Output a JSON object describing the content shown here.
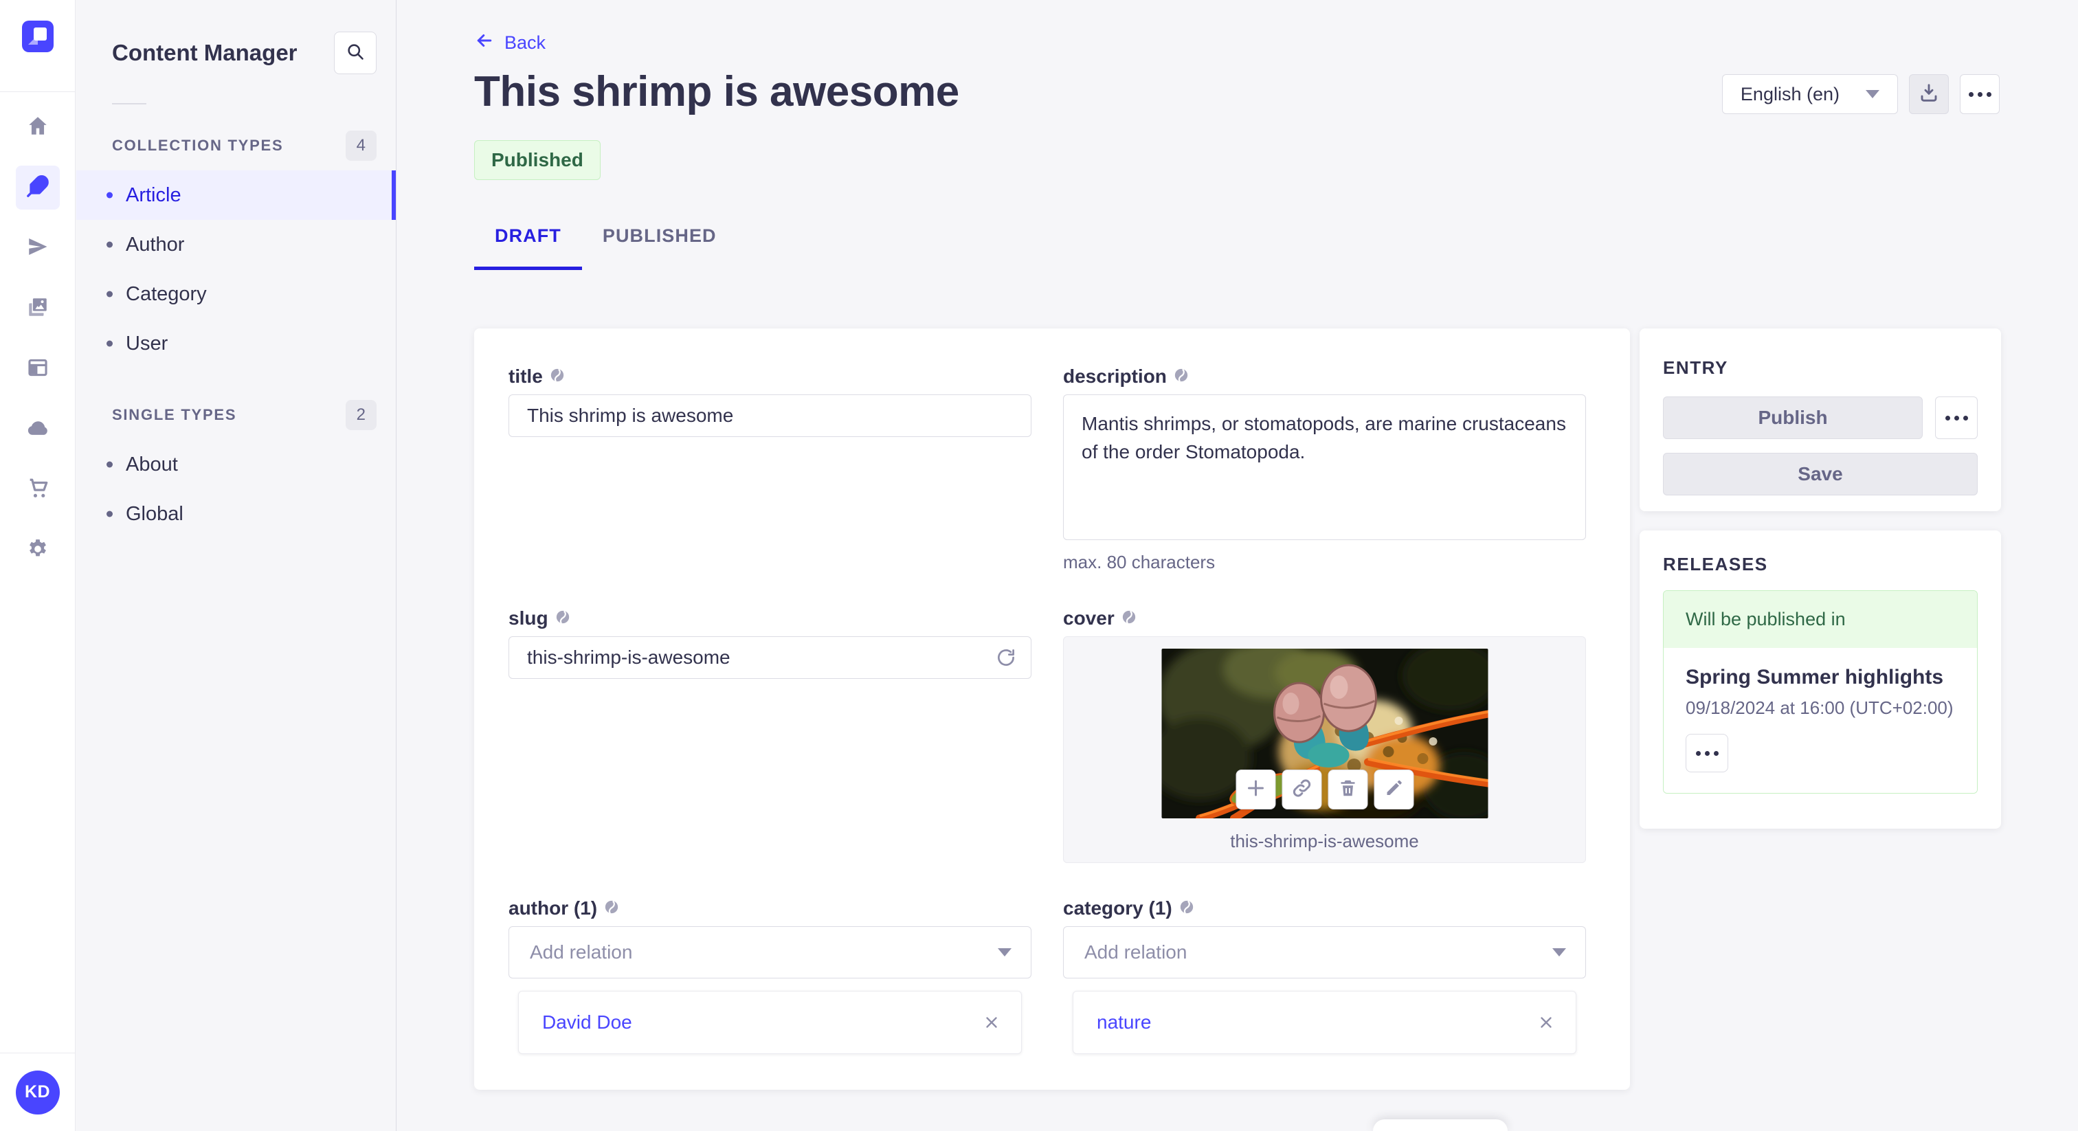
{
  "colors": {
    "primary": "#4945ff",
    "primary_dark": "#271fe0",
    "text": "#32324d",
    "text_secondary": "#666687",
    "success_text": "#2f6846",
    "success_bg": "#eafbe7",
    "success_border": "#c6f0c2",
    "page_bg": "#f6f6f9"
  },
  "rail": {
    "logo_icon": "strapi-logo",
    "icons": [
      "home-icon",
      "feather-icon",
      "paper-plane-icon",
      "media-library-icon",
      "layout-icon",
      "cloud-icon",
      "cart-icon",
      "gear-icon"
    ],
    "avatar_initials": "KD"
  },
  "sidebar": {
    "title": "Content Manager",
    "search_icon": "search-icon",
    "sections": [
      {
        "label": "COLLECTION TYPES",
        "badge": "4",
        "items": [
          {
            "label": "Article",
            "active": true
          },
          {
            "label": "Author",
            "active": false
          },
          {
            "label": "Category",
            "active": false
          },
          {
            "label": "User",
            "active": false
          }
        ]
      },
      {
        "label": "SINGLE TYPES",
        "badge": "2",
        "items": [
          {
            "label": "About",
            "active": false
          },
          {
            "label": "Global",
            "active": false
          }
        ]
      }
    ]
  },
  "header": {
    "back_label": "Back",
    "title": "This shrimp is awesome",
    "status": "Published",
    "locale": "English (en)",
    "tabs": [
      {
        "label": "DRAFT",
        "active": true
      },
      {
        "label": "PUBLISHED",
        "active": false
      }
    ]
  },
  "form": {
    "title": {
      "label": "title",
      "value": "This shrimp is awesome"
    },
    "description": {
      "label": "description",
      "value": "Mantis shrimps, or stomatopods, are marine crustaceans of the order Stomatopoda.",
      "hint": "max. 80 characters"
    },
    "slug": {
      "label": "slug",
      "value": "this-shrimp-is-awesome"
    },
    "cover": {
      "label": "cover",
      "caption": "this-shrimp-is-awesome"
    },
    "author": {
      "label": "author (1)",
      "placeholder": "Add relation",
      "relation": "David Doe"
    },
    "category": {
      "label": "category (1)",
      "placeholder": "Add relation",
      "relation": "nature"
    }
  },
  "entry_panel": {
    "heading": "ENTRY",
    "publish_label": "Publish",
    "save_label": "Save"
  },
  "releases_panel": {
    "heading": "RELEASES",
    "status": "Will be published in",
    "release_title": "Spring Summer highlights",
    "release_date": "09/18/2024 at 16:00 (UTC+02:00)"
  }
}
